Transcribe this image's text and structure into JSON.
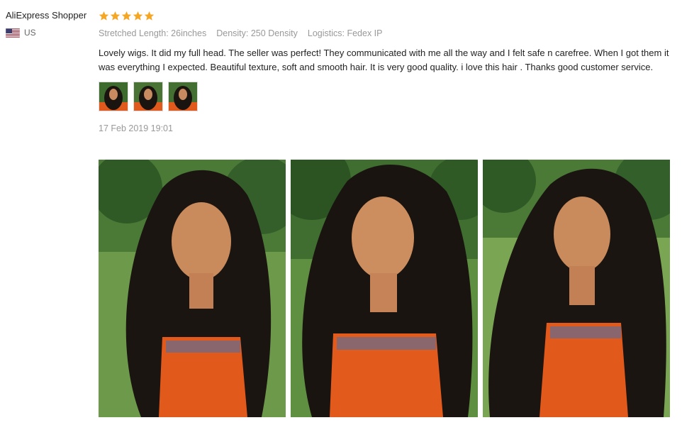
{
  "reviewer": {
    "name": "AliExpress Shopper",
    "country_code": "US",
    "flag_icon": "us-flag-icon"
  },
  "rating": {
    "stars": 5,
    "max": 5,
    "color": "#f5a623"
  },
  "attributes": [
    {
      "name": "Stretched Length:",
      "value": "26inches"
    },
    {
      "name": "Density:",
      "value": "250 Density"
    },
    {
      "name": "Logistics:",
      "value": "Fedex IP"
    }
  ],
  "review_text": "Lovely wigs. It did my full head. The seller was perfect! They communicated with me all the way and I felt safe n carefree. When I got them it was everything I expected. Beautiful texture, soft and smooth hair. It is very good quality. i love this hair . Thanks good customer service.",
  "thumbnail_count": 3,
  "date": "17 Feb 2019 19:01",
  "photo_count": 3
}
